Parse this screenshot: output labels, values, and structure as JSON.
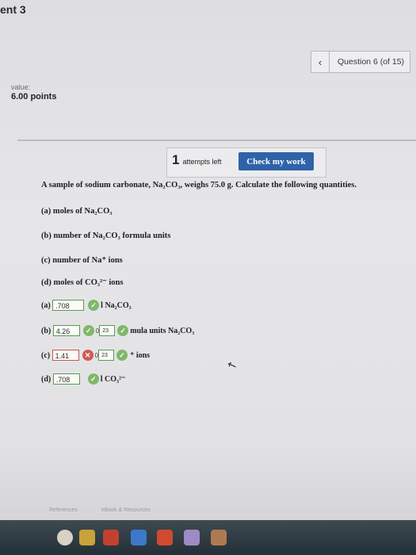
{
  "header": {
    "title": "ent 3"
  },
  "nav": {
    "prev_icon": "chevron-left-icon",
    "question_label": "Question 6 (of 15)"
  },
  "score": {
    "value_label": "value:",
    "points": "6.00 points"
  },
  "attempts": {
    "count": "1",
    "label": "attempts left"
  },
  "check_button": "Check my work",
  "problem": {
    "intro": "A sample of sodium carbonate, Na₂CO₃, weighs 75.0 g. Calculate the following quantities.",
    "parts": [
      "(a) moles of Na₂CO₃",
      "(b) number of Na₂CO₃ formula units",
      "(c) number of Na⁺ ions",
      "(d) moles of CO₃²⁻ ions"
    ]
  },
  "answers": [
    {
      "label": "(a)",
      "value": ".708",
      "unit": "l Na₂CO₃",
      "status": "correct"
    },
    {
      "label": "(b)",
      "value": "4.26",
      "exp": "23",
      "unit": "mula units Na₂CO₃",
      "status": "correct"
    },
    {
      "label": "(c)",
      "value": "1.41",
      "exp": "23",
      "unit": "⁺ ions",
      "status": "incorrect"
    },
    {
      "label": "(d)",
      "value": ".708",
      "unit": "l CO₃²⁻",
      "status": "correct"
    }
  ],
  "footer": {
    "references": "References",
    "ebook": "eBook & Resources"
  },
  "colors": {
    "button": "#2f63a8",
    "correct": "#7fb86a",
    "incorrect": "#cf5a50"
  }
}
